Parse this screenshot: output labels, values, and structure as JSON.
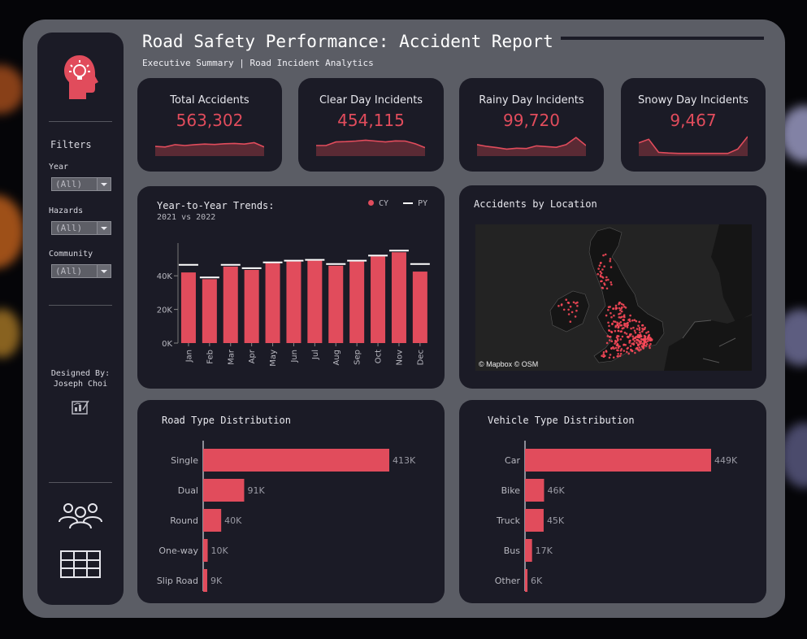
{
  "header": {
    "title": "Road Safety Performance: Accident Report",
    "subtitle": "Executive Summary | Road Incident Analytics"
  },
  "sidebar": {
    "filters_heading": "Filters",
    "filters": [
      {
        "label": "Year",
        "value": "(All)"
      },
      {
        "label": "Hazards",
        "value": "(All)"
      },
      {
        "label": "Community",
        "value": "(All)"
      }
    ],
    "designed_by_label": "Designed By:",
    "designer_name": "Joseph Choi",
    "icons": [
      "head-lightbulb-icon",
      "dashboard-sketch-icon",
      "users-icon",
      "table-grid-icon"
    ]
  },
  "kpis": [
    {
      "label": "Total Accidents",
      "value": "563,302",
      "trend": [
        0.45,
        0.42,
        0.55,
        0.5,
        0.55,
        0.58,
        0.56,
        0.6,
        0.62,
        0.58,
        0.66,
        0.42
      ]
    },
    {
      "label": "Clear Day Incidents",
      "value": "454,115",
      "trend": [
        0.5,
        0.5,
        0.7,
        0.72,
        0.75,
        0.8,
        0.75,
        0.7,
        0.76,
        0.75,
        0.6,
        0.38
      ]
    },
    {
      "label": "Rainy Day  Incidents",
      "value": "99,720",
      "trend": [
        0.55,
        0.45,
        0.38,
        0.3,
        0.35,
        0.33,
        0.48,
        0.44,
        0.4,
        0.55,
        0.95,
        0.5
      ]
    },
    {
      "label": "Snowy Day Incidents",
      "value": "9,467",
      "trend": [
        0.65,
        0.85,
        0.12,
        0.08,
        0.06,
        0.06,
        0.06,
        0.06,
        0.06,
        0.06,
        0.3,
        1.0
      ]
    }
  ],
  "trends": {
    "title": "Year-to-Year Trends:",
    "subtitle": "2021 vs 2022",
    "legend": {
      "cy": "CY",
      "py": "PY"
    }
  },
  "location": {
    "title": "Accidents by Location",
    "attribution": "© Mapbox © OSM"
  },
  "road_type": {
    "title": "Road Type Distribution"
  },
  "vehicle_type": {
    "title": "Vehicle Type Distribution"
  },
  "colors": {
    "accent": "#e14c5c",
    "card": "#1b1b26",
    "frame": "#5b5d65",
    "py_marker": "#ffffff"
  },
  "chart_data": [
    {
      "type": "bar",
      "title": "Year-to-Year Trends:",
      "subtitle": "2021 vs 2022",
      "categories": [
        "Jan",
        "Feb",
        "Mar",
        "Apr",
        "May",
        "Jun",
        "Jul",
        "Aug",
        "Sep",
        "Oct",
        "Nov",
        "Dec"
      ],
      "series": [
        {
          "name": "CY",
          "values": [
            42000,
            38000,
            45500,
            43500,
            47500,
            48500,
            49000,
            46000,
            48500,
            51500,
            54000,
            42500
          ]
        },
        {
          "name": "PY",
          "values": [
            46500,
            39000,
            46500,
            44500,
            48000,
            49000,
            49500,
            47000,
            49000,
            52000,
            55000,
            47000
          ]
        }
      ],
      "yticks": [
        "0K",
        "20K",
        "40K"
      ],
      "ylim": [
        0,
        58000
      ],
      "legend": "top-right",
      "grid": false
    },
    {
      "type": "bar",
      "orientation": "horizontal",
      "title": "Road Type Distribution",
      "categories": [
        "Single",
        "Dual",
        "Round",
        "One-way",
        "Slip Road"
      ],
      "values": [
        413000,
        91000,
        40000,
        10000,
        9000
      ],
      "labels": [
        "413K",
        "91K",
        "40K",
        "10K",
        "9K"
      ],
      "xlim": [
        0,
        413000
      ]
    },
    {
      "type": "bar",
      "orientation": "horizontal",
      "title": "Vehicle Type Distribution",
      "categories": [
        "Car",
        "Bike",
        "Truck",
        "Bus",
        "Other"
      ],
      "values": [
        449000,
        46000,
        45000,
        17000,
        6000
      ],
      "labels": [
        "449K",
        "46K",
        "45K",
        "17K",
        "6K"
      ],
      "xlim": [
        0,
        449000
      ]
    }
  ]
}
